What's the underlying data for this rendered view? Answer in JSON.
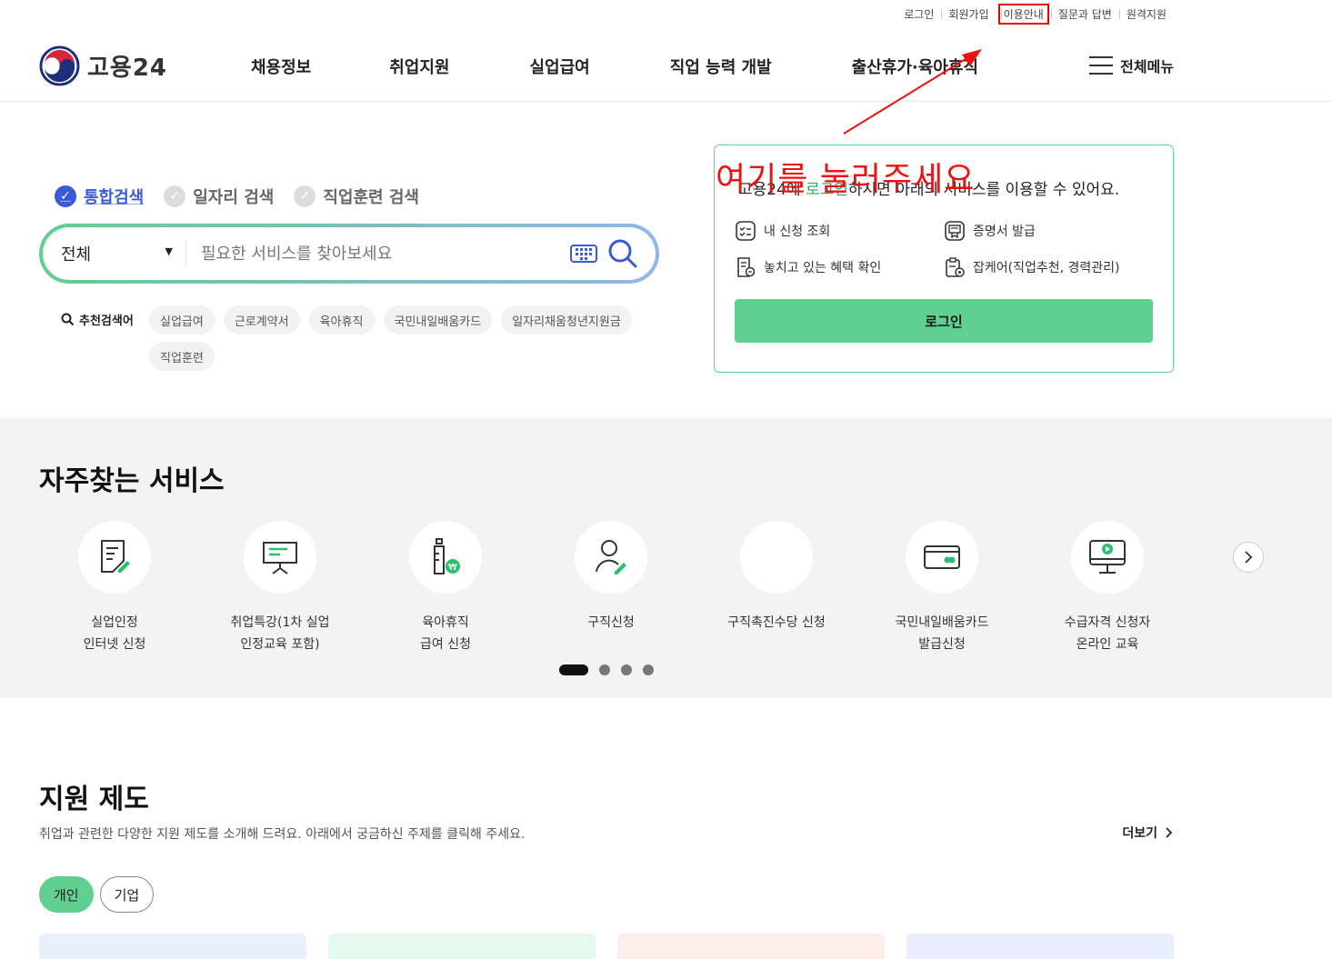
{
  "util_links": [
    "로그인",
    "회원가입",
    "이용안내",
    "질문과 답변",
    "원격지원"
  ],
  "logo": {
    "text": "고용24"
  },
  "gnb": [
    "채용정보",
    "취업지원",
    "실업급여",
    "직업 능력 개발",
    "출산휴가·육아휴직"
  ],
  "all_menu": "전체메뉴",
  "search": {
    "tabs": [
      "통합검색",
      "일자리 검색",
      "직업훈련 검색"
    ],
    "scope": "전체",
    "placeholder": "필요한 서비스를 찾아보세요",
    "recommend_label": "추천검색어",
    "keywords": [
      "실업급여",
      "근로계약서",
      "육아휴직",
      "국민내일배움카드",
      "일자리채움청년지원금",
      "직업훈련"
    ]
  },
  "login_box": {
    "title_pre": "고용24에 ",
    "title_em": "로그인",
    "title_post": "하시면 아래의 서비스를 이용할 수 있어요.",
    "items": [
      "내 신청 조회",
      "증명서 발급",
      "놓치고 있는 혜택 확인",
      "잡케어(직업추천, 경력관리)"
    ],
    "button": "로그인"
  },
  "annotation": "여기를 눌러주세요",
  "frequent": {
    "title": "자주찾는 서비스",
    "items": [
      {
        "label": "실업인정\n인터넷 신청",
        "icon": "unemployment-cert-icon"
      },
      {
        "label": "취업특강(1차 실업\n인정교육 포함)",
        "icon": "lecture-board-icon"
      },
      {
        "label": "육아휴직\n급여 신청",
        "icon": "baby-bottle-icon"
      },
      {
        "label": "구직신청",
        "icon": "job-seeker-icon"
      },
      {
        "label": "구직촉진수당 신청",
        "icon": ""
      },
      {
        "label": "국민내일배움카드\n발급신청",
        "icon": "card-icon"
      },
      {
        "label": "수급자격 신청자\n온라인 교육",
        "icon": "online-education-icon"
      }
    ]
  },
  "support": {
    "title": "지원 제도",
    "desc": "취업과 관련한 다양한 지원 제도를 소개해 드려요. 아래에서 궁금하신 주제를 클릭해 주세요.",
    "more": "더보기",
    "tabs": [
      "개인",
      "기업"
    ]
  },
  "colors": {
    "green": "#5fd08f",
    "blue": "#3a5bd9",
    "annotation_red": "#ee1111"
  }
}
